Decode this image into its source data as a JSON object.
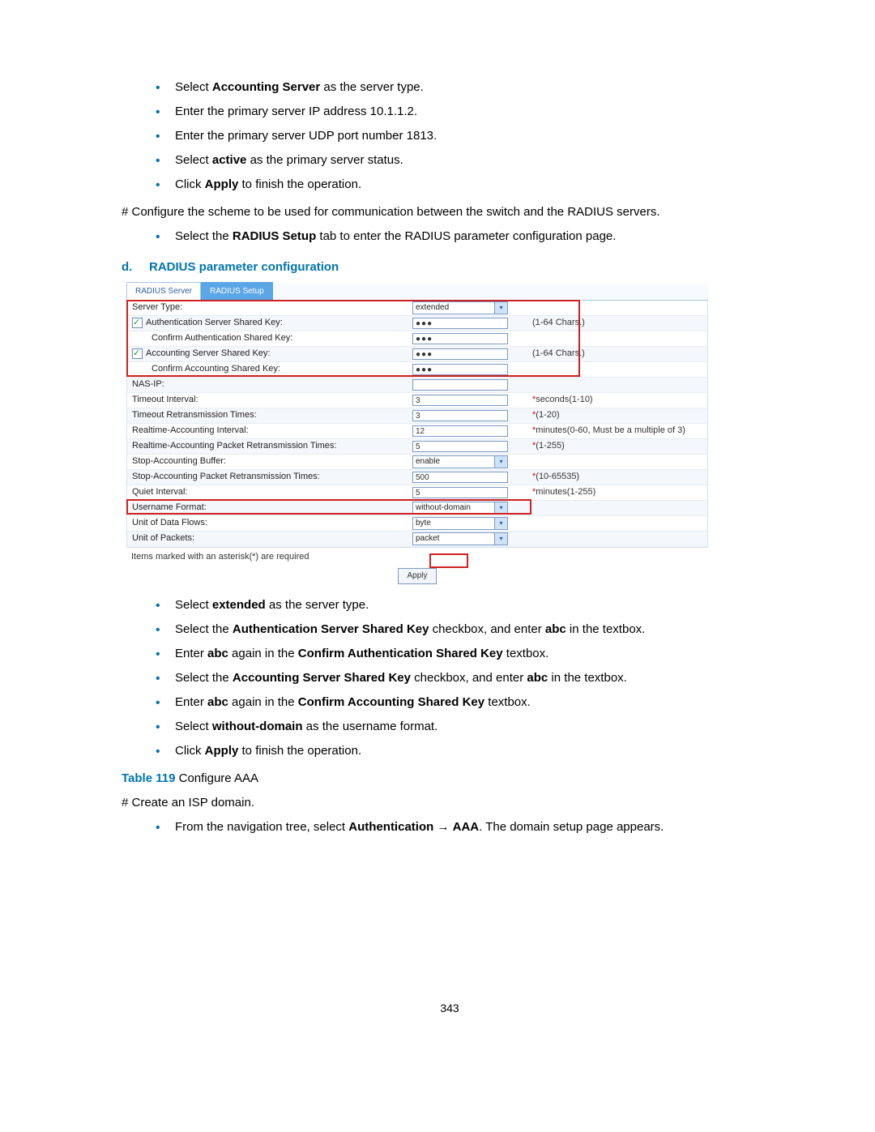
{
  "bulletsTop": [
    [
      {
        "t": "Select "
      },
      {
        "t": "Accounting Server",
        "b": true
      },
      {
        "t": " as the server type."
      }
    ],
    [
      {
        "t": "Enter the primary server IP address 10.1.1.2."
      }
    ],
    [
      {
        "t": "Enter the primary server UDP port number 1813."
      }
    ],
    [
      {
        "t": "Select "
      },
      {
        "t": "active",
        "b": true
      },
      {
        "t": " as the primary server status."
      }
    ],
    [
      {
        "t": "Click "
      },
      {
        "t": "Apply",
        "b": true
      },
      {
        "t": " to finish the operation."
      }
    ]
  ],
  "hash1": "# Configure the scheme to be used for communication between the switch and the RADIUS servers.",
  "bulletsMid": [
    [
      {
        "t": "Select the "
      },
      {
        "t": "RADIUS Setup",
        "b": true
      },
      {
        "t": " tab to enter the RADIUS parameter configuration page."
      }
    ]
  ],
  "sectionD": {
    "d": "d.",
    "title": "RADIUS parameter configuration"
  },
  "tabs": {
    "t1": "RADIUS Server",
    "t2": "RADIUS Setup"
  },
  "rows": {
    "serverType": {
      "label": "Server Type:",
      "value": "extended"
    },
    "authKey": {
      "label": "Authentication Server Shared Key:",
      "value": "●●●",
      "hint": "(1-64 Chars.)"
    },
    "confAuthKey": {
      "label": "Confirm Authentication Shared Key:",
      "value": "●●●"
    },
    "acctKey": {
      "label": "Accounting Server Shared Key:",
      "value": "●●●",
      "hint": "(1-64 Chars.)"
    },
    "confAcctKey": {
      "label": "Confirm Accounting Shared Key:",
      "value": "●●●"
    },
    "nasip": {
      "label": "NAS-IP:",
      "value": ""
    },
    "timeout": {
      "label": "Timeout Interval:",
      "value": "3",
      "hint": "seconds(1-10)",
      "star": true
    },
    "retrans": {
      "label": "Timeout Retransmission Times:",
      "value": "3",
      "hint": "(1-20)",
      "star": true
    },
    "realint": {
      "label": "Realtime-Accounting Interval:",
      "value": "12",
      "hint": "minutes(0-60, Must be a multiple of 3)",
      "star": true
    },
    "realret": {
      "label": "Realtime-Accounting Packet Retransmission Times:",
      "value": "5",
      "hint": "(1-255)",
      "star": true
    },
    "stopbuf": {
      "label": "Stop-Accounting Buffer:",
      "value": "enable"
    },
    "stopret": {
      "label": "Stop-Accounting Packet Retransmission Times:",
      "value": "500",
      "hint": "(10-65535)",
      "star": true
    },
    "quiet": {
      "label": "Quiet Interval:",
      "value": "5",
      "hint": "minutes(1-255)",
      "star": true
    },
    "userfmt": {
      "label": "Username Format:",
      "value": "without-domain"
    },
    "unitdata": {
      "label": "Unit of Data Flows:",
      "value": "byte"
    },
    "unitpkt": {
      "label": "Unit of Packets:",
      "value": "packet"
    }
  },
  "footnote": "Items marked with an asterisk(*) are required",
  "apply": "Apply",
  "bulletsBottom": [
    [
      {
        "t": "Select "
      },
      {
        "t": "extended",
        "b": true
      },
      {
        "t": " as the server type."
      }
    ],
    [
      {
        "t": "Select the "
      },
      {
        "t": "Authentication Server Shared Key",
        "b": true
      },
      {
        "t": " checkbox, and enter "
      },
      {
        "t": "abc",
        "b": true
      },
      {
        "t": " in the textbox."
      }
    ],
    [
      {
        "t": "Enter "
      },
      {
        "t": "abc",
        "b": true
      },
      {
        "t": " again in the "
      },
      {
        "t": "Confirm Authentication Shared Key",
        "b": true
      },
      {
        "t": " textbox."
      }
    ],
    [
      {
        "t": "Select the "
      },
      {
        "t": "Accounting Server Shared Key",
        "b": true
      },
      {
        "t": " checkbox, and enter "
      },
      {
        "t": "abc",
        "b": true
      },
      {
        "t": " in the textbox."
      }
    ],
    [
      {
        "t": "Enter "
      },
      {
        "t": "abc",
        "b": true
      },
      {
        "t": " again in the "
      },
      {
        "t": "Confirm Accounting Shared Key",
        "b": true
      },
      {
        "t": " textbox."
      }
    ],
    [
      {
        "t": "Select "
      },
      {
        "t": "without-domain",
        "b": true
      },
      {
        "t": " as the username format."
      }
    ],
    [
      {
        "t": "Click "
      },
      {
        "t": "Apply",
        "b": true
      },
      {
        "t": " to finish the operation."
      }
    ]
  ],
  "tableCap": {
    "num": "Table 119",
    "text": " Configure AAA"
  },
  "hash2": "# Create an ISP domain.",
  "bulletsLast": [
    [
      {
        "t": "From the navigation tree, select "
      },
      {
        "t": "Authentication",
        "b": true
      },
      {
        "t": " → "
      },
      {
        "t": "AAA",
        "b": true
      },
      {
        "t": ". The domain setup page appears."
      }
    ]
  ],
  "pageNum": "343"
}
